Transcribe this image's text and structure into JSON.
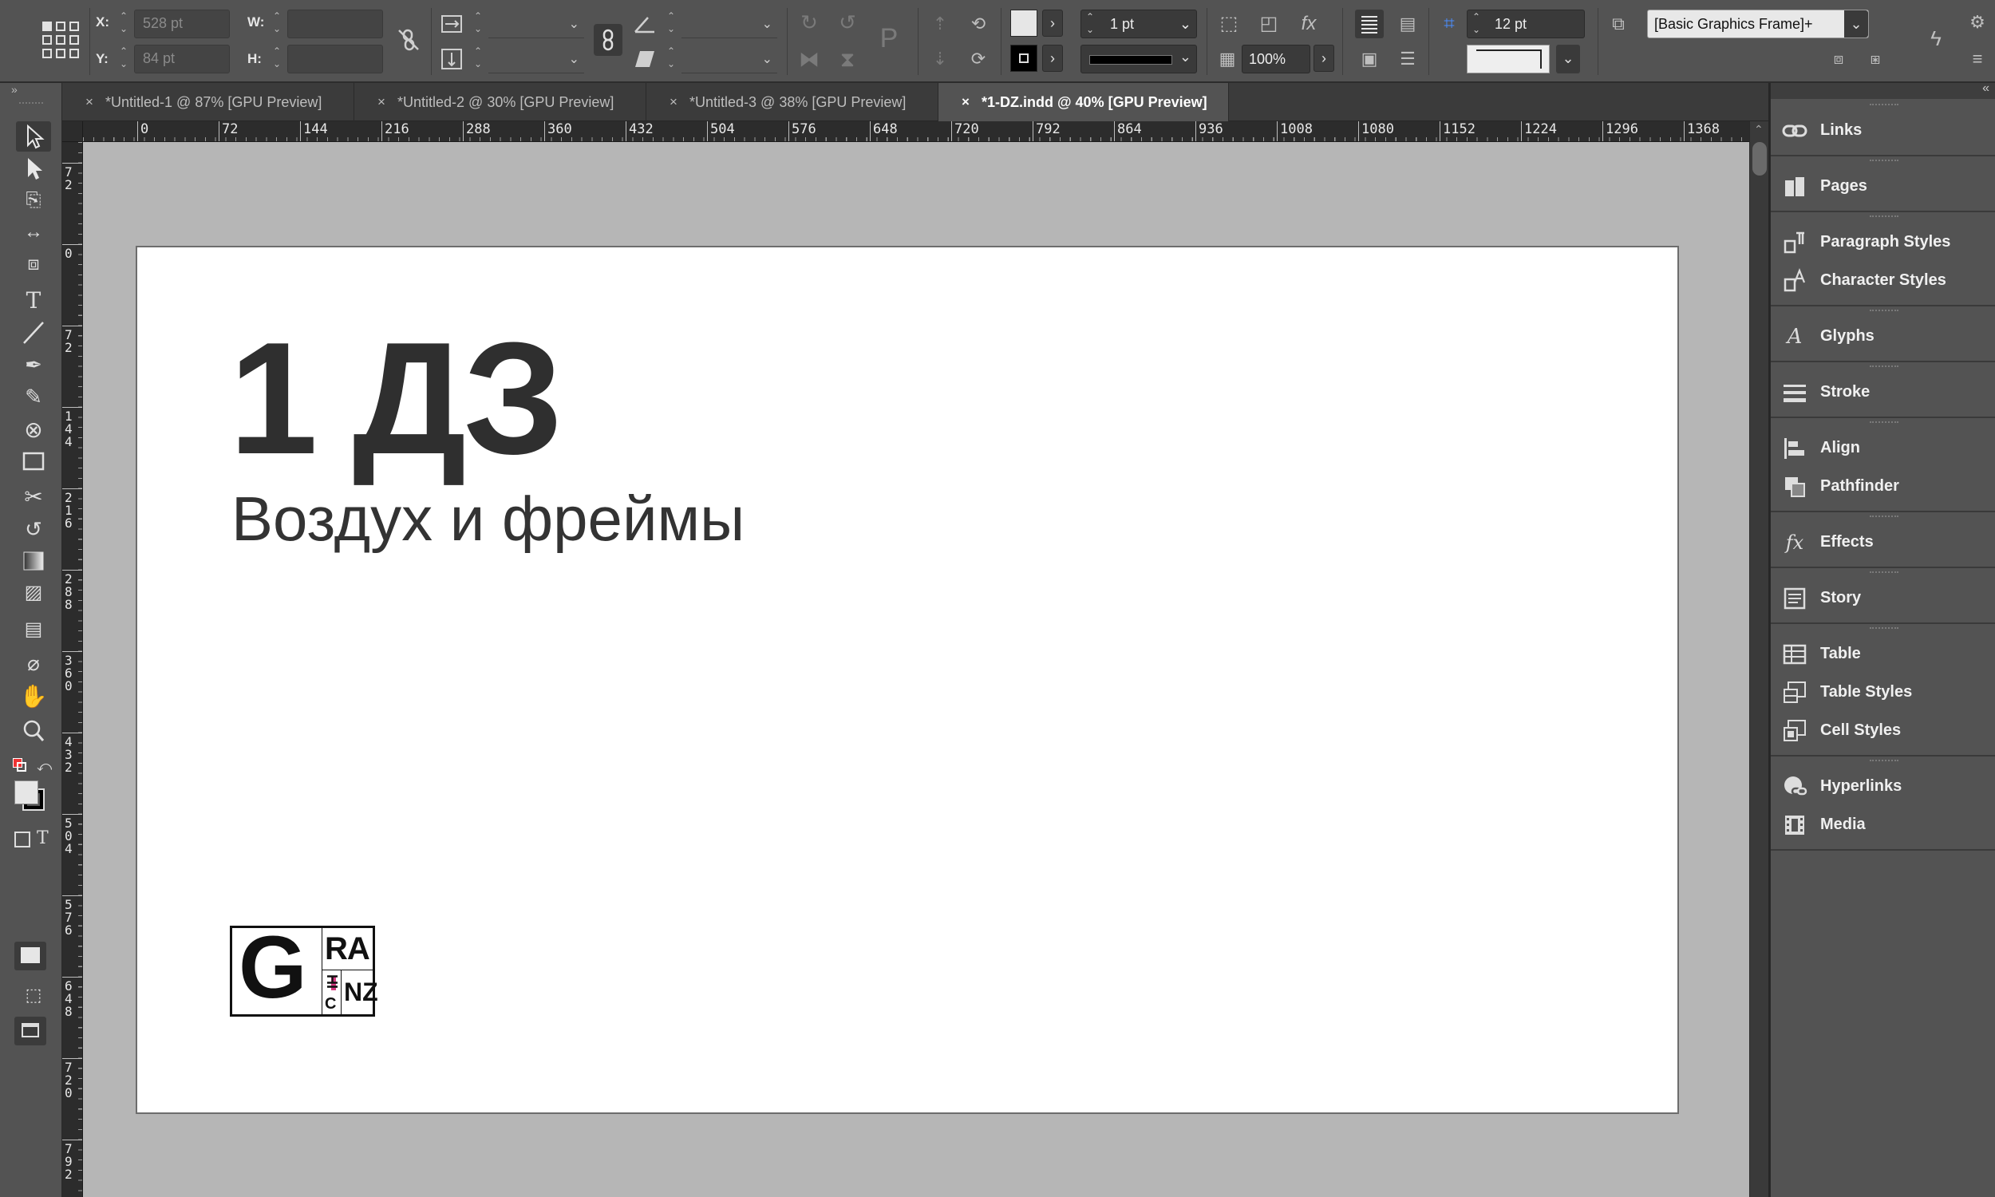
{
  "control_bar": {
    "x_label": "X:",
    "x_value": "528 pt",
    "y_label": "Y:",
    "y_value": "84 pt",
    "w_label": "W:",
    "w_value": "",
    "h_label": "H:",
    "h_value": "",
    "stroke_weight": "1 pt",
    "opacity": "100%",
    "column_gutter": "12 pt",
    "object_style": "[Basic Graphics Frame]+",
    "fill_color": "#e6e6e6",
    "stroke_color": "#000000"
  },
  "tabs": [
    {
      "close": "×",
      "title": "*Untitled-1 @ 87% [GPU Preview]",
      "active": false
    },
    {
      "close": "×",
      "title": "*Untitled-2 @ 30% [GPU Preview]",
      "active": false
    },
    {
      "close": "×",
      "title": "*Untitled-3 @ 38% [GPU Preview]",
      "active": false
    },
    {
      "close": "×",
      "title": "*1-DZ.indd @ 40% [GPU Preview]",
      "active": true
    }
  ],
  "ruler": {
    "horizontal": [
      "0",
      "72",
      "144",
      "216",
      "288",
      "360",
      "432",
      "504",
      "576",
      "648",
      "720",
      "792",
      "864",
      "936",
      "1008",
      "1080",
      "1152",
      "1224",
      "1296",
      "1368"
    ],
    "vertical": [
      "72",
      "0",
      "72",
      "144",
      "216",
      "288",
      "360",
      "432",
      "504",
      "576",
      "648",
      "720",
      "792"
    ]
  },
  "document": {
    "title": "1 ДЗ",
    "subtitle": "Воздух и фреймы",
    "logo": {
      "big_letter": "G",
      "top_letters": "RA",
      "small_a": "HI",
      "small_b": "C",
      "small_c": "NZ",
      "accent": "#d63a82"
    }
  },
  "panels": [
    [
      {
        "icon": "links-icon",
        "label": "Links"
      }
    ],
    [
      {
        "icon": "pages-icon",
        "label": "Pages"
      }
    ],
    [
      {
        "icon": "paragraph-styles-icon",
        "label": "Paragraph Styles"
      },
      {
        "icon": "character-styles-icon",
        "label": "Character Styles"
      }
    ],
    [
      {
        "icon": "glyphs-icon",
        "label": "Glyphs"
      }
    ],
    [
      {
        "icon": "stroke-icon",
        "label": "Stroke"
      }
    ],
    [
      {
        "icon": "align-icon",
        "label": "Align"
      },
      {
        "icon": "pathfinder-icon",
        "label": "Pathfinder"
      }
    ],
    [
      {
        "icon": "effects-icon",
        "label": "Effects"
      }
    ],
    [
      {
        "icon": "story-icon",
        "label": "Story"
      }
    ],
    [
      {
        "icon": "table-icon",
        "label": "Table"
      },
      {
        "icon": "table-styles-icon",
        "label": "Table Styles"
      },
      {
        "icon": "cell-styles-icon",
        "label": "Cell Styles"
      }
    ],
    [
      {
        "icon": "hyperlinks-icon",
        "label": "Hyperlinks"
      },
      {
        "icon": "media-icon",
        "label": "Media"
      }
    ]
  ],
  "colors": {
    "ui_dark": "#323232",
    "ui_mid": "#535353",
    "pasteboard": "#b6b6b6",
    "page": "#ffffff",
    "selection": "#2d7ff9"
  }
}
